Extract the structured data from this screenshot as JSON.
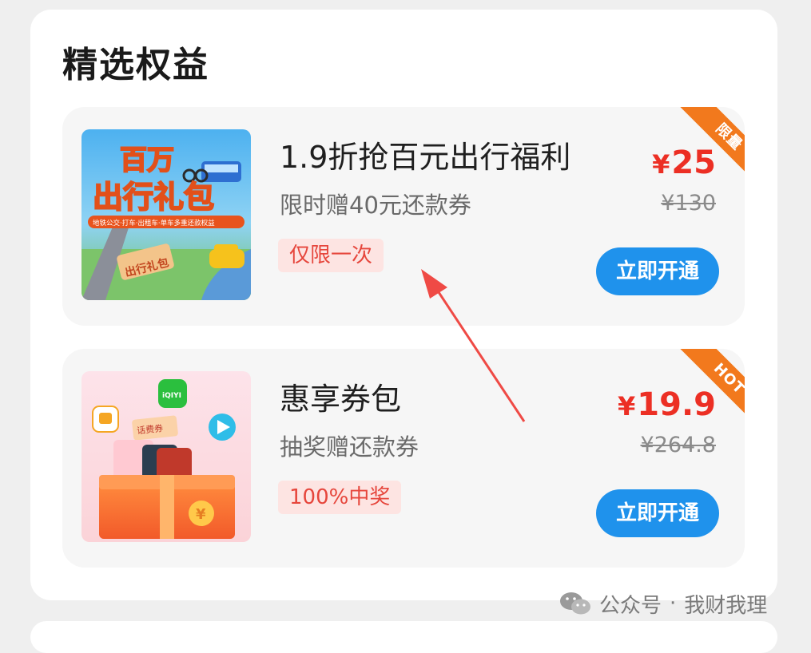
{
  "section": {
    "title": "精选权益"
  },
  "cards": [
    {
      "badge": "限量",
      "thumb": {
        "line1": "百万",
        "line2": "出行礼包",
        "caption": "地铁公交·打车·出租车·单车多重还款权益",
        "sign": "出行礼包"
      },
      "title": "1.9折抢百元出行福利",
      "subtitle": "限时赠40元还款券",
      "tag": "仅限一次",
      "price": "25",
      "currency": "¥",
      "original_price": "¥130",
      "button": "立即开通"
    },
    {
      "badge": "HOT",
      "thumb": {
        "coupon_label": "话费券",
        "app_badge": "iQIYI"
      },
      "title": "惠享券包",
      "subtitle": "抽奖赠还款券",
      "tag": "100%中奖",
      "price": "19.9",
      "currency": "¥",
      "original_price": "¥264.8",
      "button": "立即开通"
    }
  ],
  "watermark": {
    "platform": "公众号",
    "separator": "·",
    "account": "我财我理"
  },
  "colors": {
    "accent_blue": "#1f92ec",
    "price_red": "#ec2f24",
    "ribbon_orange": "#f2791d",
    "tag_bg": "#fde4e2",
    "annotation_arrow": "#ef4a45"
  }
}
